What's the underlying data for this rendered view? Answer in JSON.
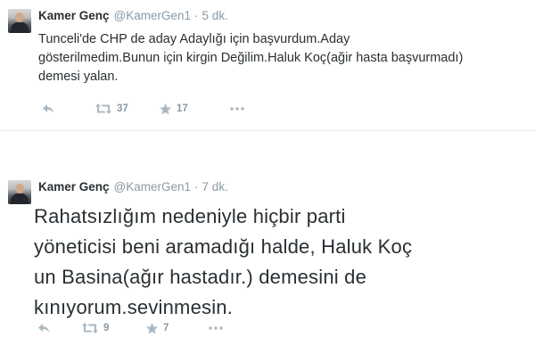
{
  "tweets": [
    {
      "name": "Kamer Genç",
      "handle": "@KamerGen1",
      "separator": "·",
      "time": "5 dk.",
      "text_lines": [
        "Tunceli'de CHP de aday Adaylığı için başvurdum.Aday",
        "gösterilmedim.Bunun için kirgin Değilim.Haluk Koç(ağir hasta başvurmadı)",
        "demesi yalan."
      ],
      "retweets": "37",
      "favorites": "17"
    },
    {
      "name": "Kamer Genç",
      "handle": "@KamerGen1",
      "separator": "·",
      "time": "7 dk.",
      "text_lines": [
        "Rahatsızlığım nedeniyle hiçbir parti",
        "yöneticisi beni aramadığı halde, Haluk Koç",
        "un Basina(ağır hastadır.) demesini de",
        "kınıyorum.sevinmesin."
      ],
      "retweets": "9",
      "favorites": "7"
    }
  ],
  "icons": {
    "reply": "reply-icon",
    "retweet": "retweet-icon",
    "favorite": "star-icon",
    "more": "more-icon"
  },
  "colors": {
    "text": "#292f33",
    "muted": "#8899a6",
    "icon": "#aab8c2",
    "divider": "#e6ecf0"
  }
}
